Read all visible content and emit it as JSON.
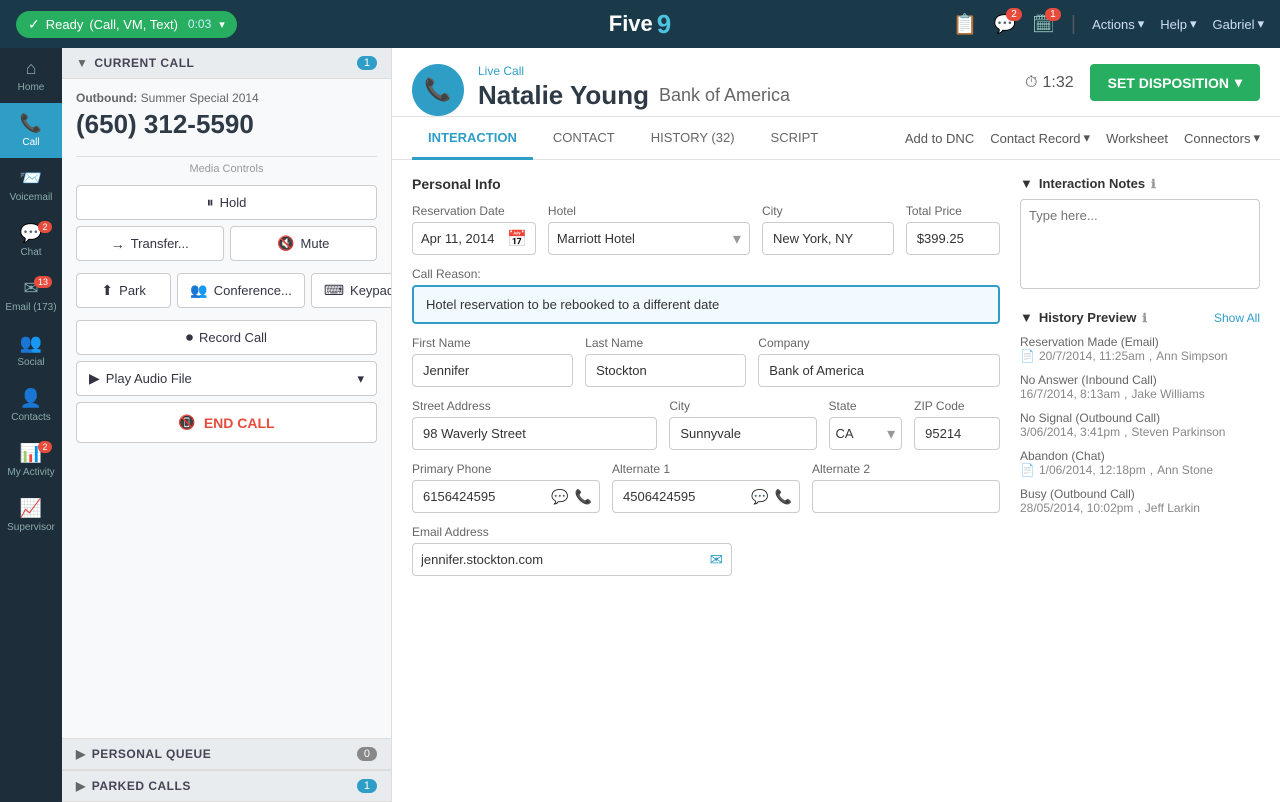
{
  "topbar": {
    "ready_label": "Ready",
    "ready_modes": "(Call, VM, Text)",
    "ready_timer": "0:03",
    "actions_label": "Actions",
    "help_label": "Help",
    "user_label": "Gabriel"
  },
  "logo": {
    "text": "Five",
    "cloud": "9"
  },
  "nav": {
    "items": [
      {
        "id": "home",
        "icon": "⌂",
        "label": "Home",
        "badge": null
      },
      {
        "id": "call",
        "icon": "📞",
        "label": "Call",
        "badge": null
      },
      {
        "id": "voicemail",
        "icon": "📨",
        "label": "Voicemail",
        "badge": null
      },
      {
        "id": "chat",
        "icon": "💬",
        "label": "Chat",
        "badge": "2"
      },
      {
        "id": "email",
        "icon": "✉",
        "label": "Email (173)",
        "badge": "13"
      },
      {
        "id": "social",
        "icon": "👥",
        "label": "Social",
        "badge": null
      },
      {
        "id": "contacts",
        "icon": "👤",
        "label": "Contacts",
        "badge": null
      },
      {
        "id": "my-activity",
        "icon": "📊",
        "label": "My Activity",
        "badge": "2"
      },
      {
        "id": "supervisor",
        "icon": "📈",
        "label": "Supervisor",
        "badge": null
      }
    ]
  },
  "current_call_section": {
    "title": "CURRENT CALL",
    "badge": "1",
    "outbound_label": "Outbound:",
    "campaign": "Summer Special 2014",
    "phone_number": "(650) 312-5590",
    "media_controls_label": "Media Controls",
    "buttons": {
      "hold": "Hold",
      "transfer": "Transfer...",
      "mute": "Mute",
      "park": "Park",
      "conference": "Conference...",
      "keypad": "Keypad",
      "record_call": "Record Call",
      "play_audio": "Play Audio File",
      "end_call": "END CALL"
    }
  },
  "personal_queue": {
    "title": "PERSONAL QUEUE",
    "badge": "0"
  },
  "parked_calls": {
    "title": "PARKED CALLS",
    "badge": "1"
  },
  "call_header": {
    "live_call_label": "Live Call",
    "contact_name": "Natalie Young",
    "company": "Bank of America",
    "timer": "1:32",
    "set_disposition_label": "SET DISPOSITION"
  },
  "tabs": {
    "items": [
      {
        "id": "interaction",
        "label": "INTERACTION",
        "active": true
      },
      {
        "id": "contact",
        "label": "CONTACT",
        "active": false
      },
      {
        "id": "history",
        "label": "HISTORY (32)",
        "active": false
      },
      {
        "id": "script",
        "label": "SCRIPT",
        "active": false
      }
    ],
    "actions": [
      {
        "id": "add-to-dnc",
        "label": "Add to DNC"
      },
      {
        "id": "contact-record",
        "label": "Contact Record"
      },
      {
        "id": "worksheet",
        "label": "Worksheet"
      },
      {
        "id": "connectors",
        "label": "Connectors"
      }
    ]
  },
  "form": {
    "section_title": "Personal Info",
    "reservation_date_label": "Reservation Date",
    "reservation_date": "Apr 11, 2014",
    "hotel_label": "Hotel",
    "hotel_value": "Marriott Hotel",
    "city_label": "City",
    "city_value": "New York, NY",
    "total_price_label": "Total Price",
    "total_price_value": "$399.25",
    "call_reason_label": "Call Reason:",
    "call_reason_value": "Hotel reservation to be rebooked to a different date",
    "first_name_label": "First Name",
    "first_name_value": "Jennifer",
    "last_name_label": "Last Name",
    "last_name_value": "Stockton",
    "company_label": "Company",
    "company_value": "Bank of America",
    "street_address_label": "Street Address",
    "street_address_value": "98 Waverly Street",
    "city2_label": "City",
    "city2_value": "Sunnyvale",
    "state_label": "State",
    "state_value": "CA",
    "zip_label": "ZIP Code",
    "zip_value": "95214",
    "primary_phone_label": "Primary Phone",
    "primary_phone_value": "6156424595",
    "alt1_label": "Alternate 1",
    "alt1_value": "4506424595",
    "alt2_label": "Alternate 2",
    "alt2_value": "",
    "email_label": "Email Address",
    "email_value": "jennifer.stockton.com"
  },
  "interaction_notes": {
    "title": "Interaction Notes",
    "placeholder": "Type here..."
  },
  "history_preview": {
    "title": "History Preview",
    "show_all": "Show All",
    "items": [
      {
        "title": "Reservation Made",
        "type": "Email",
        "date": "20/7/2014, 11:25am",
        "agent": "Ann Simpson",
        "has_doc": true
      },
      {
        "title": "No Answer",
        "type": "Inbound Call",
        "date": "16/7/2014, 8:13am",
        "agent": "Jake Williams",
        "has_doc": false
      },
      {
        "title": "No Signal",
        "type": "Outbound Call",
        "date": "3/06/2014, 3:41pm",
        "agent": "Steven Parkinson",
        "has_doc": false
      },
      {
        "title": "Abandon",
        "type": "Chat",
        "date": "1/06/2014, 12:18pm",
        "agent": "Ann Stone",
        "has_doc": true
      },
      {
        "title": "Busy",
        "type": "Outbound Call",
        "date": "28/05/2014, 10:02pm",
        "agent": "Jeff Larkin",
        "has_doc": false
      }
    ]
  }
}
